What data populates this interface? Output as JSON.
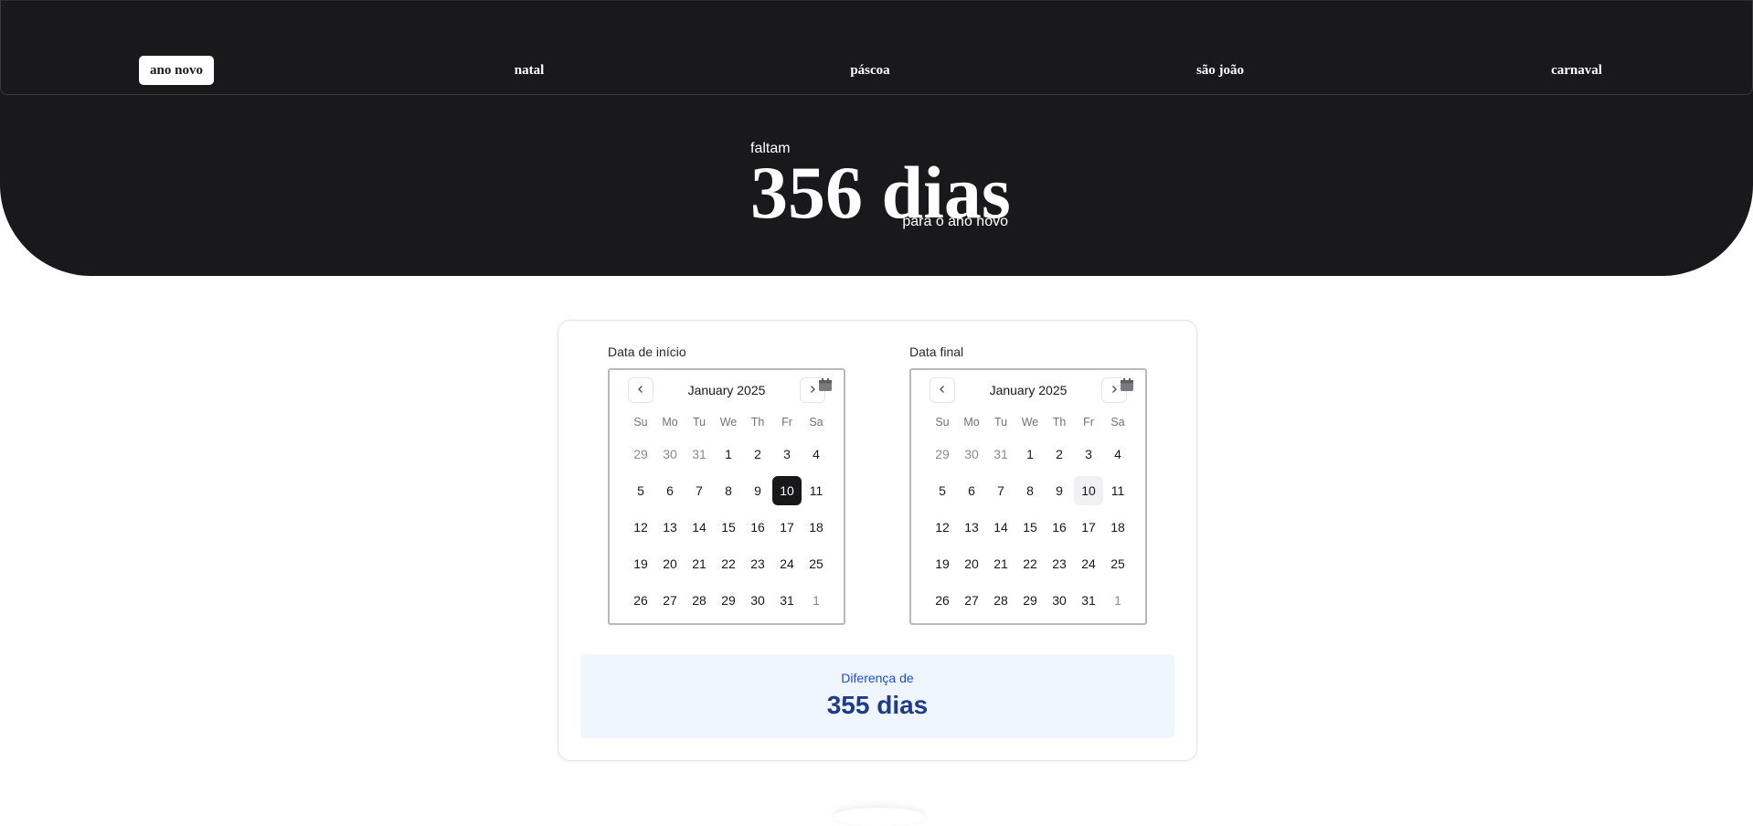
{
  "nav": {
    "tabs": [
      {
        "label": "ano novo",
        "active": true
      },
      {
        "label": "natal",
        "active": false
      },
      {
        "label": "páscoa",
        "active": false
      },
      {
        "label": "são joão",
        "active": false
      },
      {
        "label": "carnaval",
        "active": false
      }
    ]
  },
  "countdown": {
    "prefix": "faltam",
    "value": "356 dias",
    "suffix": "para o ano novo"
  },
  "start_calendar": {
    "label": "Data de início",
    "month_title": "January 2025",
    "prev_icon": "chevron-left-icon",
    "next_icon": "chevron-right-icon",
    "calendar_icon": "calendar-icon",
    "selected_day": "10"
  },
  "end_calendar": {
    "label": "Data final",
    "month_title": "January 2025",
    "prev_icon": "chevron-left-icon",
    "next_icon": "chevron-right-icon",
    "calendar_icon": "calendar-icon",
    "highlighted_day": "10"
  },
  "weekdays": [
    "Su",
    "Mo",
    "Tu",
    "We",
    "Th",
    "Fr",
    "Sa"
  ],
  "weeks": [
    [
      "29",
      "30",
      "31",
      "1",
      "2",
      "3",
      "4"
    ],
    [
      "5",
      "6",
      "7",
      "8",
      "9",
      "10",
      "11"
    ],
    [
      "12",
      "13",
      "14",
      "15",
      "16",
      "17",
      "18"
    ],
    [
      "19",
      "20",
      "21",
      "22",
      "23",
      "24",
      "25"
    ],
    [
      "26",
      "27",
      "28",
      "29",
      "30",
      "31",
      "1"
    ]
  ],
  "result": {
    "label": "Diferença de",
    "value": "355 dias"
  },
  "colors": {
    "hero_bg": "#19191b",
    "selected_bg": "#18181b",
    "result_bg": "#eff6ff",
    "result_text": "#1e3a8a",
    "result_label": "#1d4ed8"
  }
}
